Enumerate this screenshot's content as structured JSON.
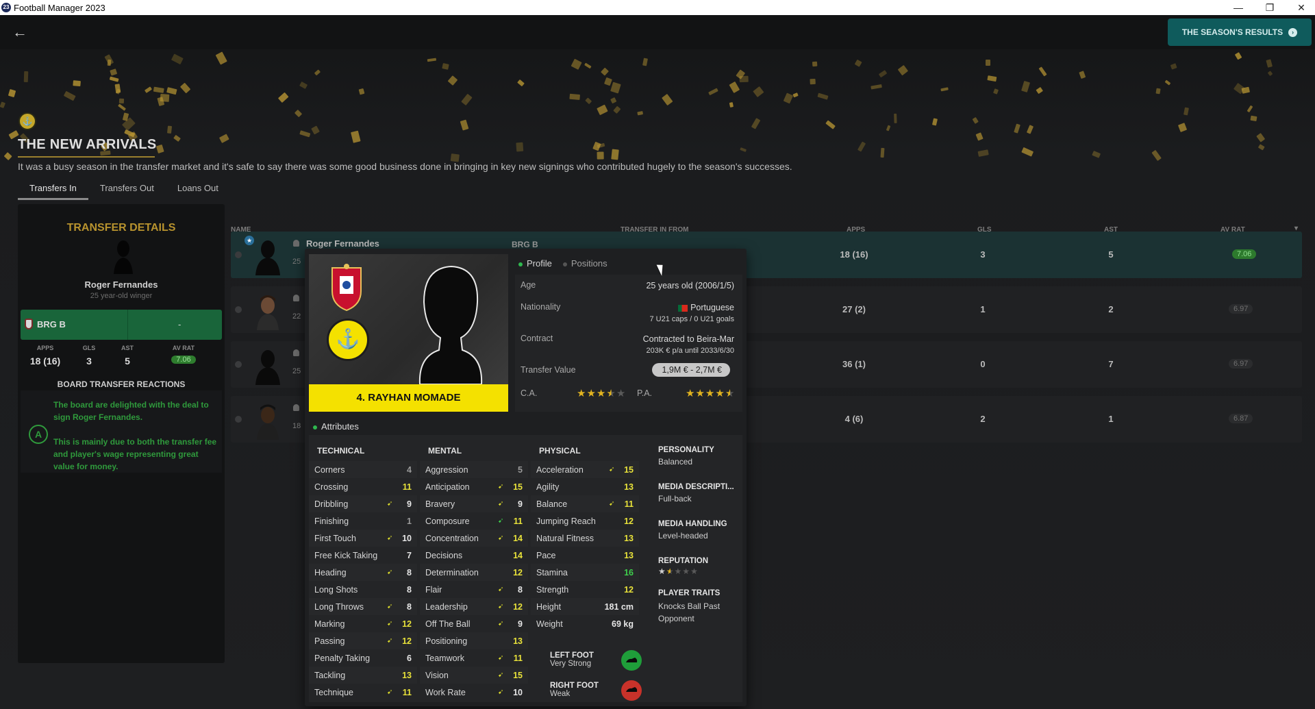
{
  "window": {
    "title": "Football Manager 2023",
    "icon_text": "23",
    "minimize": "—",
    "restore": "❐",
    "close": "✕"
  },
  "header": {
    "back_icon": "←",
    "results_button": "THE SEASON'S RESULTS",
    "results_arrow": "›"
  },
  "section": {
    "title": "THE NEW ARRIVALS",
    "description": "It was a busy season in the transfer market and it's safe to say there was some good business done in bringing in key new signings who contributed hugely to the season's successes.",
    "tabs": [
      "Transfers In",
      "Transfers Out",
      "Loans Out"
    ]
  },
  "transfer_details": {
    "title": "TRANSFER DETAILS",
    "player_name": "Roger Fernandes",
    "player_sub": "25 year-old winger",
    "from_club": "BRG B",
    "fee": "-",
    "stats": {
      "apps_label": "APPS",
      "apps": "18 (16)",
      "gls_label": "GLS",
      "gls": "3",
      "ast_label": "AST",
      "ast": "5",
      "rat_label": "AV RAT",
      "rat": "7.06"
    },
    "reactions_title": "BOARD TRANSFER REACTIONS",
    "grade": "A",
    "reaction_1": "The board are delighted with the deal to sign Roger Fernandes.",
    "reaction_2": "This is mainly due to both the transfer fee and player's wage representing great value for money."
  },
  "table": {
    "columns": {
      "name": "NAME",
      "from": "TRANSFER IN FROM",
      "apps": "APPS",
      "gls": "GLS",
      "ast": "AST",
      "rat": "AV RAT"
    },
    "rows": [
      {
        "name": "Roger Fernandes",
        "age": "25",
        "club": "BRG B",
        "fee": "-",
        "apps": "18 (16)",
        "gls": "3",
        "ast": "5",
        "rat": "7.06"
      },
      {
        "name": "",
        "age": "22",
        "club": "",
        "fee": "",
        "apps": "27 (2)",
        "gls": "1",
        "ast": "2",
        "rat": "6.97"
      },
      {
        "name": "",
        "age": "25",
        "club": "",
        "fee": "",
        "apps": "36 (1)",
        "gls": "0",
        "ast": "7",
        "rat": "6.97"
      },
      {
        "name": "",
        "age": "18",
        "club": "",
        "fee": "",
        "apps": "4 (6)",
        "gls": "2",
        "ast": "1",
        "rat": "6.87"
      }
    ]
  },
  "popup": {
    "player": "4. RAYHAN MOMADE",
    "tabs": [
      "Profile",
      "Positions"
    ],
    "profile": {
      "age_label": "Age",
      "age": "25 years old (2006/1/5)",
      "nationality_label": "Nationality",
      "nationality": "Portuguese",
      "caps": "7 U21 caps / 0 U21 goals",
      "contract_label": "Contract",
      "contract": "Contracted to Beira-Mar",
      "wage": "203K € p/a until 2033/6/30",
      "value_label": "Transfer Value",
      "value": "1,9M € - 2,7M €",
      "ca_label": "C.A.",
      "pa_label": "P.A.",
      "ca_stars": 3.5,
      "pa_stars": 4.5
    },
    "attributes_label": "Attributes",
    "technical_title": "TECHNICAL",
    "technical": [
      {
        "name": "Corners",
        "value": "4"
      },
      {
        "name": "Crossing",
        "value": "11"
      },
      {
        "name": "Dribbling",
        "value": "9"
      },
      {
        "name": "Finishing",
        "value": "1"
      },
      {
        "name": "First Touch",
        "value": "10"
      },
      {
        "name": "Free Kick Taking",
        "value": "7"
      },
      {
        "name": "Heading",
        "value": "8"
      },
      {
        "name": "Long Shots",
        "value": "8"
      },
      {
        "name": "Long Throws",
        "value": "8"
      },
      {
        "name": "Marking",
        "value": "12"
      },
      {
        "name": "Passing",
        "value": "12"
      },
      {
        "name": "Penalty Taking",
        "value": "6"
      },
      {
        "name": "Tackling",
        "value": "13"
      },
      {
        "name": "Technique",
        "value": "11"
      }
    ],
    "mental_title": "MENTAL",
    "mental": [
      {
        "name": "Aggression",
        "value": "5"
      },
      {
        "name": "Anticipation",
        "value": "15"
      },
      {
        "name": "Bravery",
        "value": "9"
      },
      {
        "name": "Composure",
        "value": "11"
      },
      {
        "name": "Concentration",
        "value": "14"
      },
      {
        "name": "Decisions",
        "value": "14"
      },
      {
        "name": "Determination",
        "value": "12"
      },
      {
        "name": "Flair",
        "value": "8"
      },
      {
        "name": "Leadership",
        "value": "12"
      },
      {
        "name": "Off The Ball",
        "value": "9"
      },
      {
        "name": "Positioning",
        "value": "13"
      },
      {
        "name": "Teamwork",
        "value": "11"
      },
      {
        "name": "Vision",
        "value": "15"
      },
      {
        "name": "Work Rate",
        "value": "10"
      }
    ],
    "physical_title": "PHYSICAL",
    "physical": [
      {
        "name": "Acceleration",
        "value": "15"
      },
      {
        "name": "Agility",
        "value": "13"
      },
      {
        "name": "Balance",
        "value": "11"
      },
      {
        "name": "Jumping Reach",
        "value": "12"
      },
      {
        "name": "Natural Fitness",
        "value": "13"
      },
      {
        "name": "Pace",
        "value": "13"
      },
      {
        "name": "Stamina",
        "value": "16"
      },
      {
        "name": "Strength",
        "value": "12"
      },
      {
        "name": "Height",
        "value": "181 cm"
      },
      {
        "name": "Weight",
        "value": "69 kg"
      }
    ],
    "feet": {
      "left_label": "LEFT FOOT",
      "left": "Very Strong",
      "right_label": "RIGHT FOOT",
      "right": "Weak"
    },
    "side": {
      "personality_label": "PERSONALITY",
      "personality": "Balanced",
      "media_desc_label": "MEDIA DESCRIPTI...",
      "media_desc": "Full-back",
      "media_handling_label": "MEDIA HANDLING",
      "media_handling": "Level-headed",
      "reputation_label": "REPUTATION",
      "reputation_stars": 1.5,
      "traits_label": "PLAYER TRAITS",
      "traits": "Knocks Ball Past Opponent"
    }
  },
  "colors": {
    "accent_teal": "#0f5b5c",
    "gold": "#b8932e",
    "green": "#2f9a3c",
    "yellow": "#f4e100"
  }
}
